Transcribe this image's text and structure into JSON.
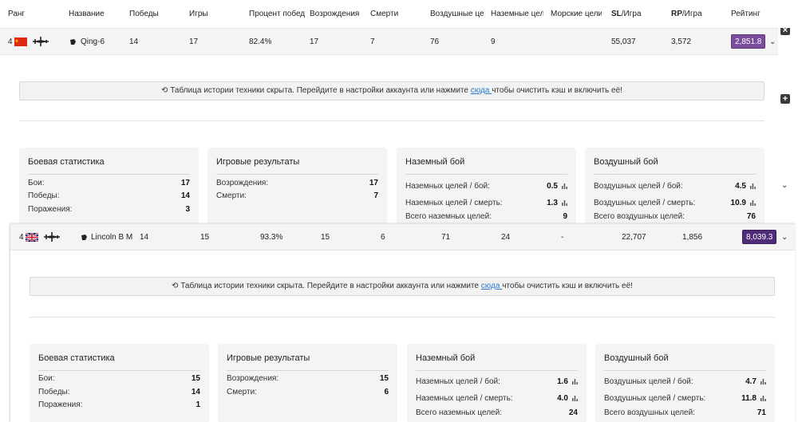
{
  "header": {
    "rank": "Ранг",
    "name": "Название",
    "wins": "Победы",
    "games": "Игры",
    "win_rate": "Процент побед",
    "respawns": "Возрождения",
    "deaths": "Смерти",
    "air_targets": "Воздушные цели",
    "ground_targets": "Наземные цели",
    "naval_targets": "Морские цели",
    "sl_prefix": "SL",
    "sl_suffix": "/Игра",
    "rp_prefix": "RP",
    "rp_suffix": "/Игра",
    "rating": "Рейтинг"
  },
  "colors": {
    "rating_1": "#7a4d9c",
    "rating_2": "#4f2c78",
    "accent_link": "#2a7bd0"
  },
  "vehicles": [
    {
      "rank": "4",
      "name": "Qing-6",
      "flag": "china-flag",
      "wins": "14",
      "games": "17",
      "win_rate": "82.4%",
      "respawns": "17",
      "deaths": "7",
      "air": "76",
      "ground": "9",
      "naval": "",
      "sl": "55,037",
      "rp": "3,572",
      "rating": "2,851.8",
      "notice": {
        "before": "Таблица истории техники скрыта. Перейдите в настройки аккаунта или нажмите ",
        "link": "сюда ",
        "after": "чтобы очистить кэш и включить её!"
      },
      "battle": {
        "title": "Боевая статистика",
        "battles_l": "Бои:",
        "battles_v": "17",
        "wins_l": "Победы:",
        "wins_v": "14",
        "losses_l": "Поражения:",
        "losses_v": "3"
      },
      "game": {
        "title": "Игровые результаты",
        "respawns_l": "Возрождения:",
        "respawns_v": "17",
        "deaths_l": "Смерти:",
        "deaths_v": "7"
      },
      "ground_combat": {
        "title": "Наземный бой",
        "per_battle_l": "Наземных целей / бой:",
        "per_battle_v": "0.5",
        "per_death_l": "Наземных целей / смерть:",
        "per_death_v": "1.3",
        "total_l": "Всего наземных целей:",
        "total_v": "9"
      },
      "air_combat": {
        "title": "Воздушный бой",
        "per_battle_l": "Воздушных целей / бой:",
        "per_battle_v": "4.5",
        "per_death_l": "Воздушных целей / смерть:",
        "per_death_v": "10.9",
        "total_l": "Всего воздушных целей:",
        "total_v": "76"
      }
    },
    {
      "rank": "4",
      "name": "Lincoln B M",
      "flag": "uk-flag",
      "wins": "14",
      "games": "15",
      "win_rate": "93.3%",
      "respawns": "15",
      "deaths": "6",
      "air": "71",
      "ground": "24",
      "naval": "-",
      "sl": "22,707",
      "rp": "1,856",
      "rating": "8,039.3",
      "notice": {
        "before": "Таблица истории техники скрыта. Перейдите в настройки аккаунта или нажмите ",
        "link": "сюда ",
        "after": "чтобы очистить кэш и включить её!"
      },
      "battle": {
        "title": "Боевая статистика",
        "battles_l": "Бои:",
        "battles_v": "15",
        "wins_l": "Победы:",
        "wins_v": "14",
        "losses_l": "Поражения:",
        "losses_v": "1"
      },
      "game": {
        "title": "Игровые результаты",
        "respawns_l": "Возрождения:",
        "respawns_v": "15",
        "deaths_l": "Смерти:",
        "deaths_v": "6"
      },
      "ground_combat": {
        "title": "Наземный бой",
        "per_battle_l": "Наземных целей / бой:",
        "per_battle_v": "1.6",
        "per_death_l": "Наземных целей / смерть:",
        "per_death_v": "4.0",
        "total_l": "Всего наземных целей:",
        "total_v": "24"
      },
      "air_combat": {
        "title": "Воздушный бой",
        "per_battle_l": "Воздушных целей / бой:",
        "per_battle_v": "4.7",
        "per_death_l": "Воздушных целей / смерть:",
        "per_death_v": "11.8",
        "total_l": "Всего воздушных целей:",
        "total_v": "71"
      }
    }
  ]
}
